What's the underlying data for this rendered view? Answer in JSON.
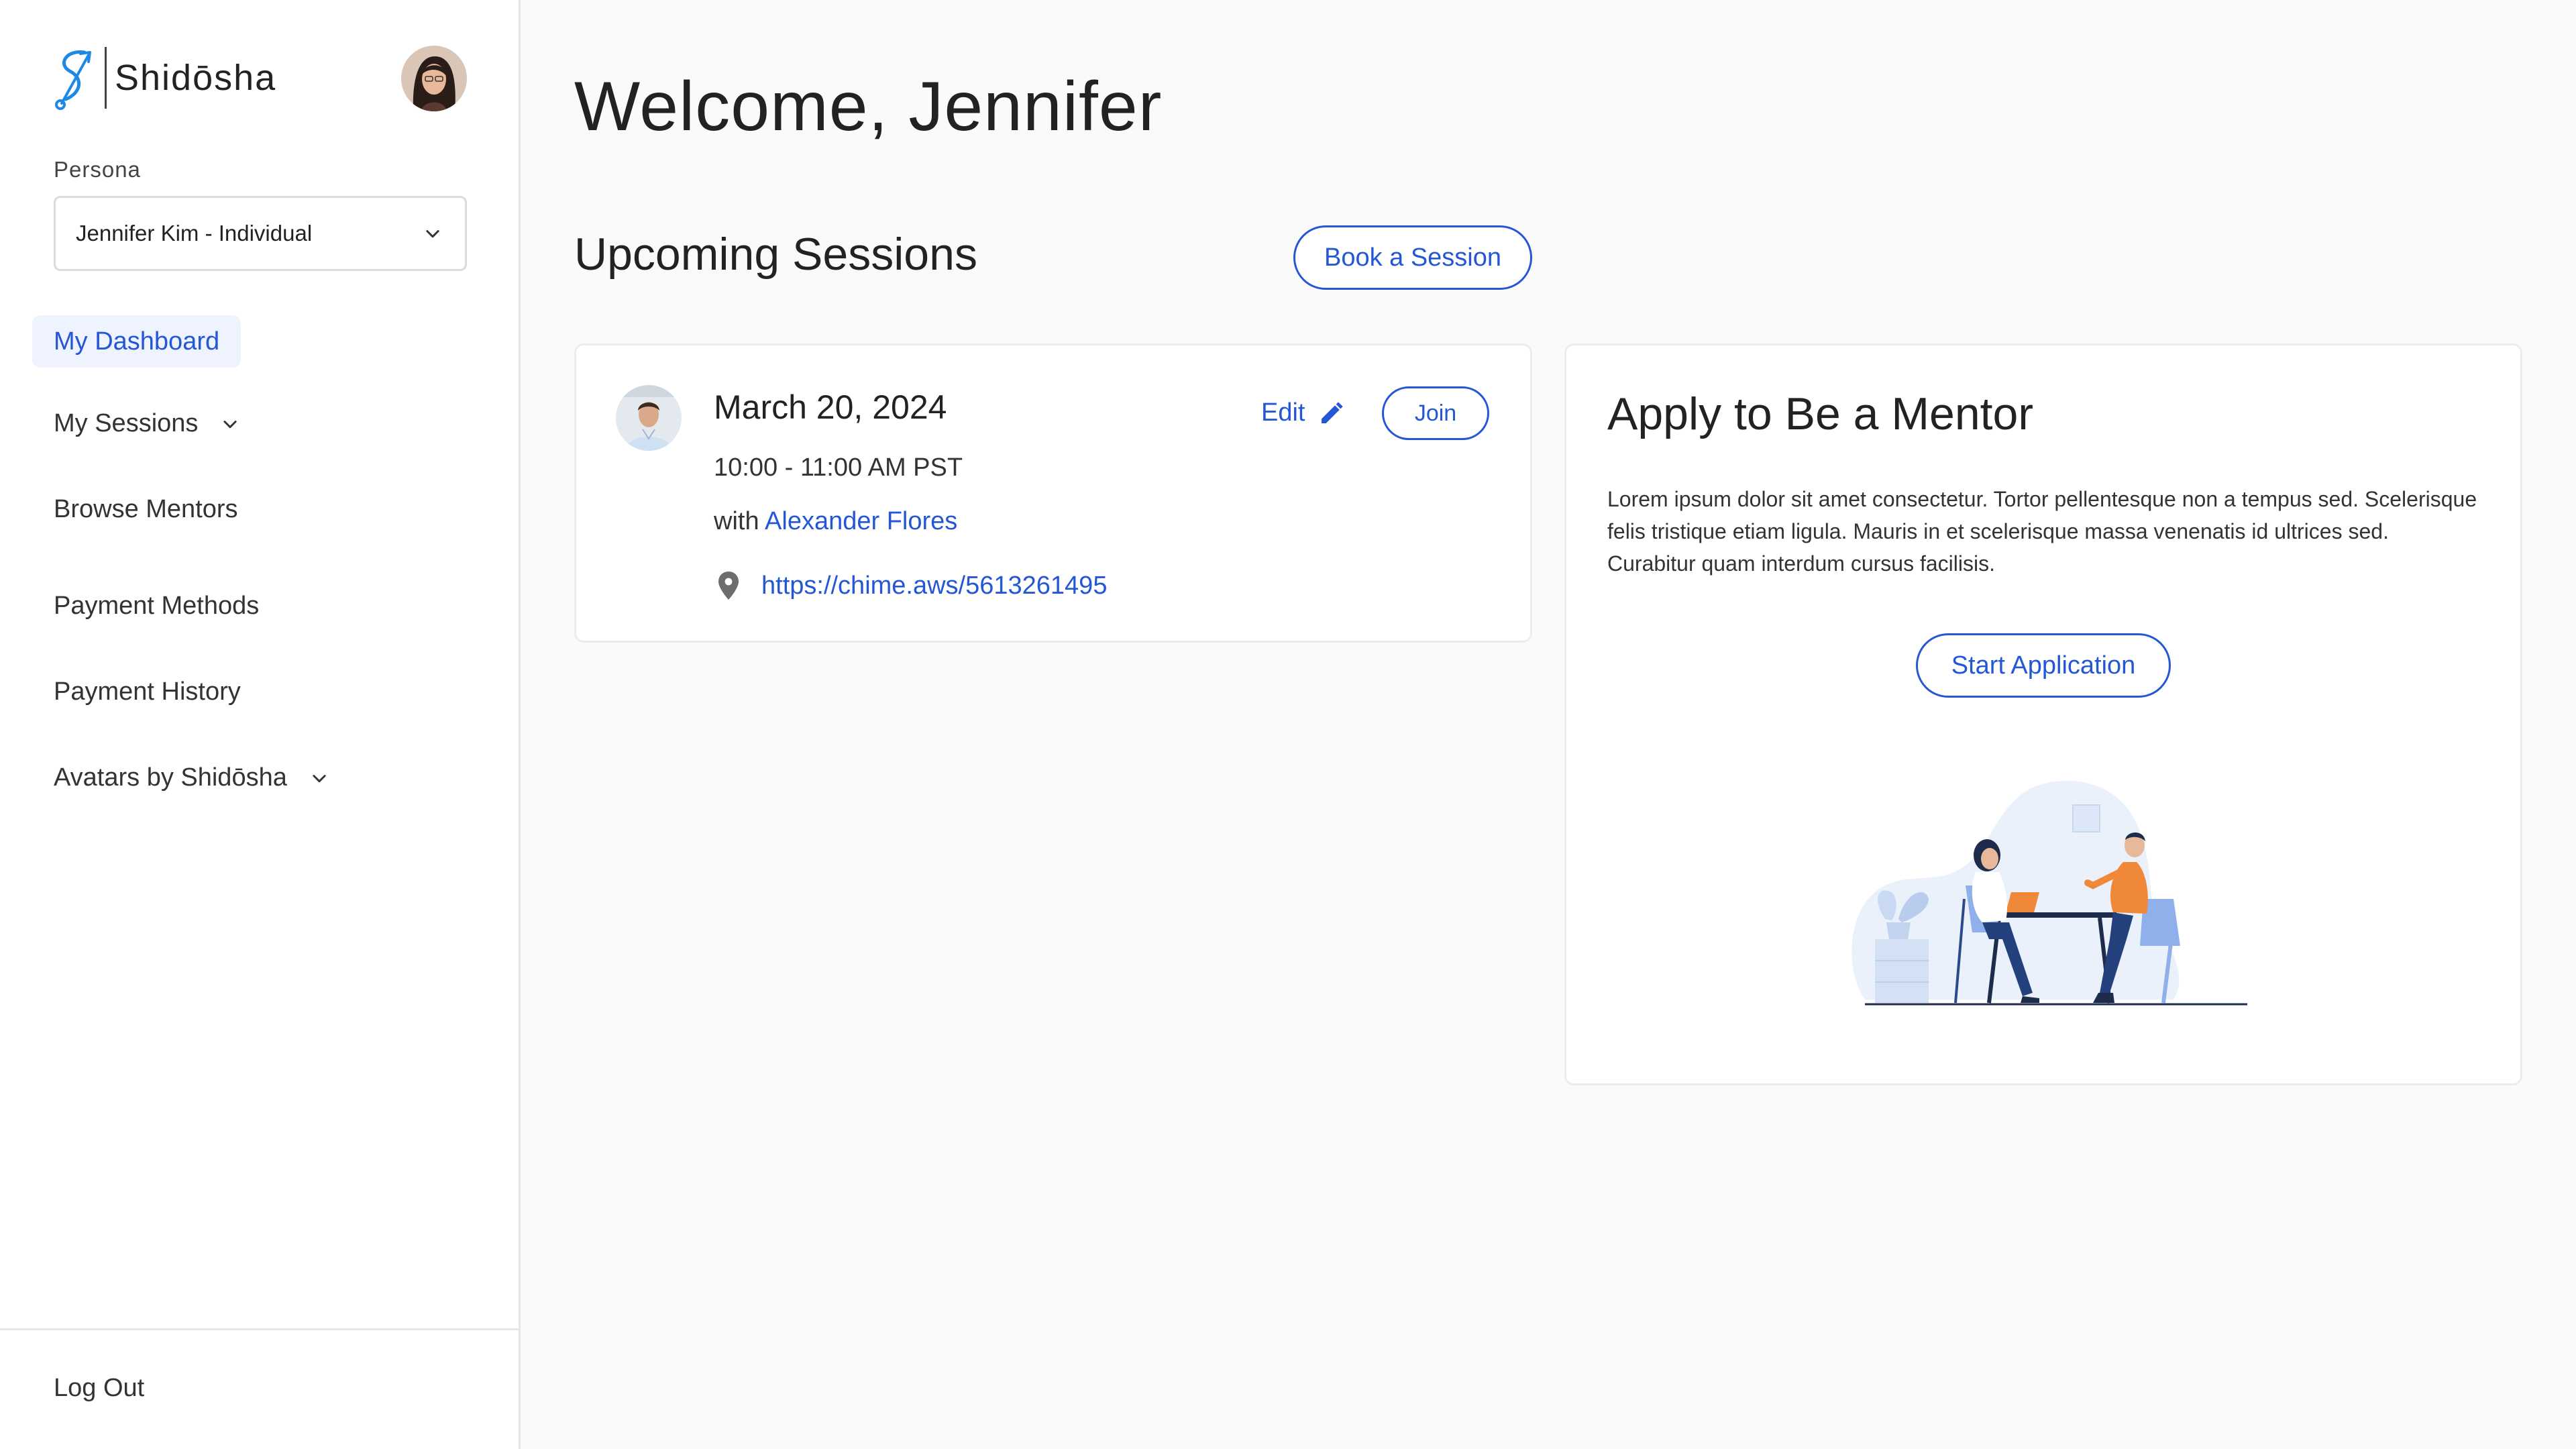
{
  "brand": {
    "name": "Shidōsha"
  },
  "sidebar": {
    "persona_label": "Persona",
    "persona_value": "Jennifer Kim - Individual",
    "nav": {
      "dashboard": "My Dashboard",
      "sessions": "My Sessions",
      "browse": "Browse Mentors",
      "payment_methods": "Payment Methods",
      "payment_history": "Payment History",
      "avatars": "Avatars by Shidōsha"
    },
    "logout": "Log Out"
  },
  "main": {
    "welcome": "Welcome, Jennifer",
    "upcoming_title": "Upcoming Sessions",
    "book_button": "Book a Session",
    "session": {
      "date": "March 20, 2024",
      "time": "10:00 - 11:00 AM PST",
      "with_prefix": "with",
      "mentor": "Alexander Flores",
      "link": "https://chime.aws/5613261495",
      "edit": "Edit",
      "join": "Join"
    },
    "mentor_card": {
      "title": "Apply to Be a Mentor",
      "body": "Lorem ipsum dolor sit amet consectetur. Tortor pellentesque non a tempus sed. Scelerisque felis tristique etiam ligula. Mauris in et scelerisque massa venenatis id ultrices sed. Curabitur quam interdum cursus facilisis.",
      "button": "Start Application"
    }
  },
  "colors": {
    "accent": "#2457d6",
    "active_bg": "#eef3fd",
    "background": "#fafafa"
  },
  "icons": [
    "logo-mark-icon",
    "user-avatar",
    "chevron-down-icon",
    "location-pin-icon",
    "pencil-icon",
    "mentor-avatar"
  ]
}
